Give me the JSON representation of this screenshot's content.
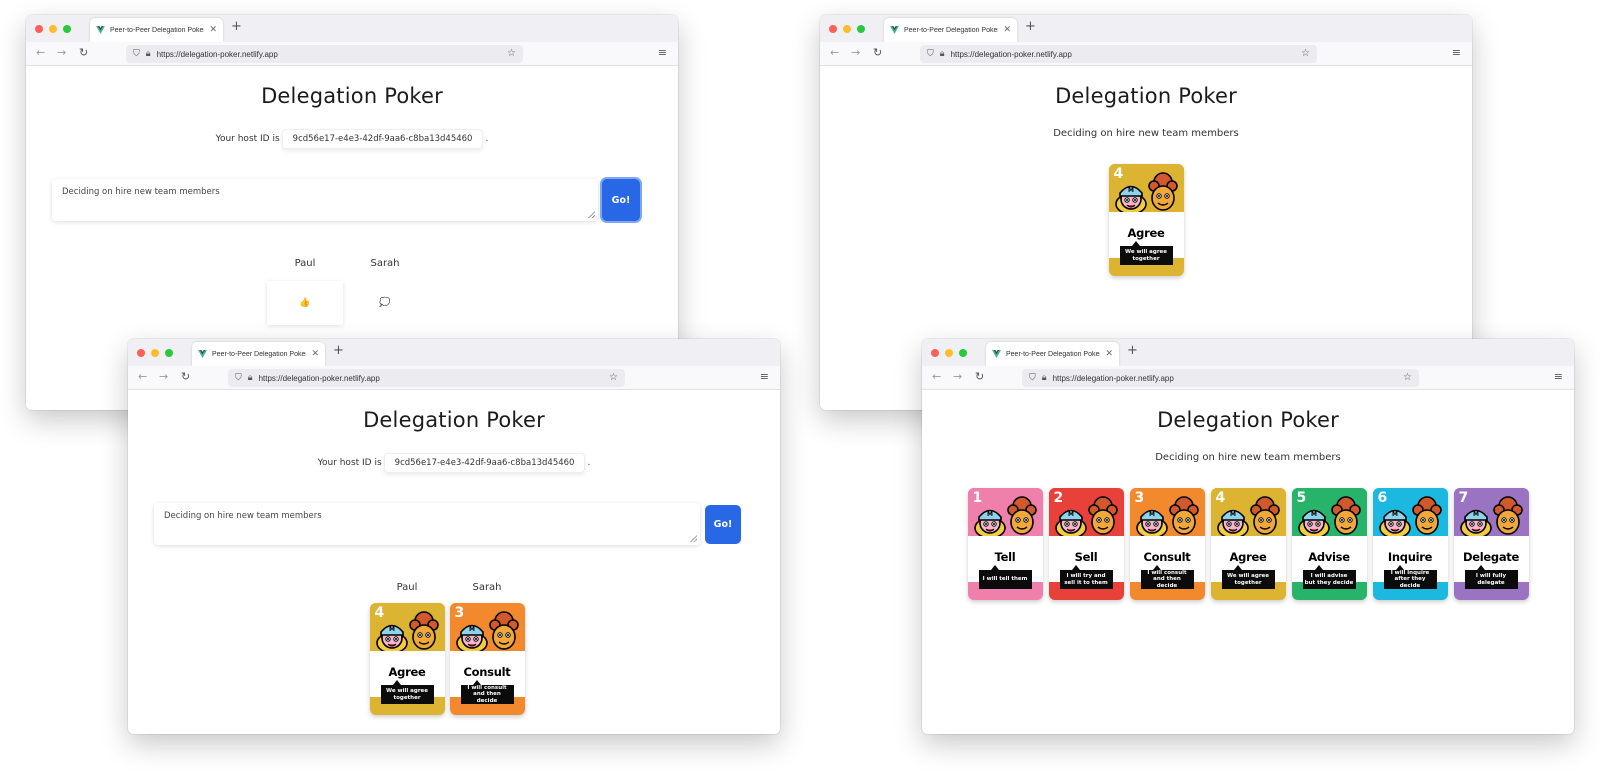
{
  "colors": {
    "go_button": "#2867e6",
    "card_tell": "#ef7fab",
    "card_sell": "#e8413a",
    "card_consult": "#f28a2d",
    "card_agree": "#dcb431",
    "card_advise": "#27b36a",
    "card_inquire": "#1db8df",
    "card_delegate": "#9a73c2"
  },
  "browser": {
    "tab_title": "Peer-to-Peer Delegation Poker",
    "url": "https://delegation-poker.netlify.app",
    "icons": [
      "vue-logo-icon",
      "close-icon",
      "plus-icon",
      "back-arrow-icon",
      "forward-arrow-icon",
      "reload-icon",
      "shield-icon",
      "lock-icon",
      "star-icon",
      "hamburger-menu-icon"
    ]
  },
  "app": {
    "title": "Delegation Poker",
    "host_label": "Your host ID is",
    "host_id": "9cd56e17-e4e3-42df-9aa6-c8ba13d45460",
    "host_suffix": ".",
    "topic": "Deciding on hire new team members",
    "go_label": "Go!"
  },
  "players": [
    {
      "name": "Paul",
      "status_icon": "👍"
    },
    {
      "name": "Sarah",
      "status_icon": "💭"
    }
  ],
  "cards": [
    {
      "number": "1",
      "name": "Tell",
      "desc": "I will tell them",
      "color": "#ef7fab"
    },
    {
      "number": "2",
      "name": "Sell",
      "desc": "I will try and sell it to them",
      "color": "#e8413a"
    },
    {
      "number": "3",
      "name": "Consult",
      "desc": "I will consult and then decide",
      "color": "#f28a2d"
    },
    {
      "number": "4",
      "name": "Agree",
      "desc": "We will agree together",
      "color": "#dcb431"
    },
    {
      "number": "5",
      "name": "Advise",
      "desc": "I will advise but they decide",
      "color": "#27b36a"
    },
    {
      "number": "6",
      "name": "Inquire",
      "desc": "I will inquire after they decide",
      "color": "#1db8df"
    },
    {
      "number": "7",
      "name": "Delegate",
      "desc": "I will fully delegate",
      "color": "#9a73c2"
    }
  ]
}
